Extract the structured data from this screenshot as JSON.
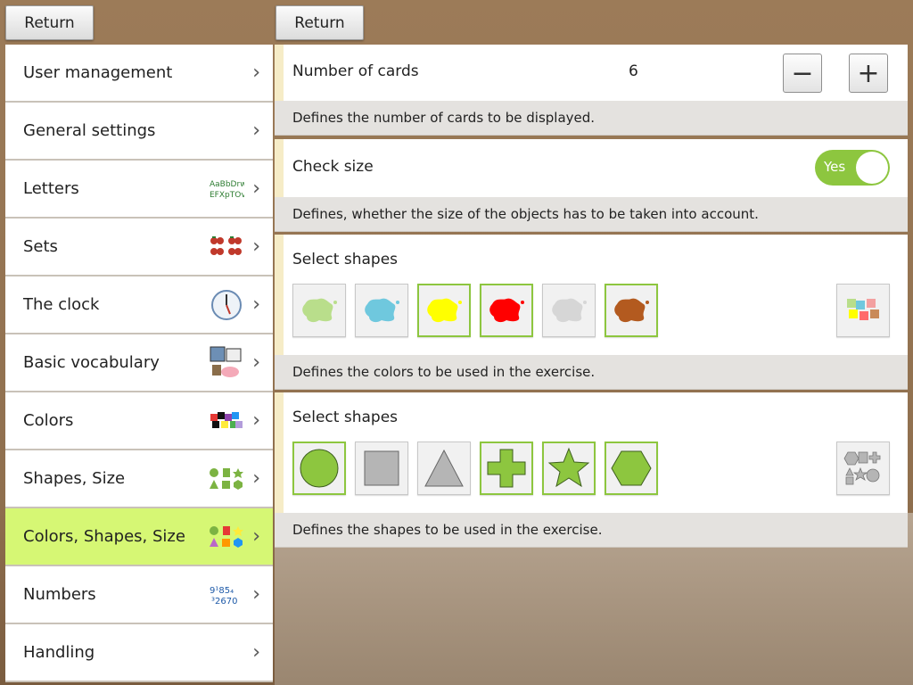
{
  "buttons": {
    "return_left": "Return",
    "return_right": "Return"
  },
  "menu": {
    "items": [
      {
        "label": "User management",
        "icon": "none",
        "active": false
      },
      {
        "label": "General settings",
        "icon": "none",
        "active": false
      },
      {
        "label": "Letters",
        "icon": "letters-icon",
        "active": false
      },
      {
        "label": "Sets",
        "icon": "strawberry-sets-icon",
        "active": false
      },
      {
        "label": "The clock",
        "icon": "clock-icon",
        "active": false
      },
      {
        "label": "Basic vocabulary",
        "icon": "vocabulary-icon",
        "active": false
      },
      {
        "label": "Colors",
        "icon": "color-puzzle-icon",
        "active": false
      },
      {
        "label": "Shapes, Size",
        "icon": "shapes-icon",
        "active": false
      },
      {
        "label": "Colors, Shapes, Size",
        "icon": "colored-shapes-icon",
        "active": true
      },
      {
        "label": "Numbers",
        "icon": "numbers-icon",
        "active": false
      },
      {
        "label": "Handling",
        "icon": "none",
        "active": false
      }
    ],
    "letters_icon_text": "AaBbDrwEFXpTOv",
    "numbers_icon_text": "9¹85₄³2670"
  },
  "settings": {
    "cards": {
      "label": "Number of cards",
      "value": "6",
      "minus": "−",
      "plus": "+",
      "description": "Defines the number of cards to be displayed."
    },
    "check_size": {
      "label": "Check size",
      "toggle_text": "Yes",
      "enabled": true,
      "description": "Defines, whether the size of the objects has to be taken into account."
    },
    "colors": {
      "label": "Select shapes",
      "swatches": [
        {
          "color": "#b9de8b",
          "selected": false
        },
        {
          "color": "#6fc8de",
          "selected": false
        },
        {
          "color": "#ffff00",
          "selected": true
        },
        {
          "color": "#ff0000",
          "selected": true
        },
        {
          "color": "#d6d6d6",
          "selected": false
        },
        {
          "color": "#b35a1f",
          "selected": true
        }
      ],
      "description": "Defines the colors to be used in the exercise."
    },
    "shapes": {
      "label": "Select shapes",
      "items": [
        {
          "shape": "circle",
          "selected": true
        },
        {
          "shape": "square",
          "selected": false
        },
        {
          "shape": "triangle",
          "selected": false
        },
        {
          "shape": "cross",
          "selected": true
        },
        {
          "shape": "star",
          "selected": true
        },
        {
          "shape": "hexagon",
          "selected": true
        }
      ],
      "description": "Defines the shapes to be used in the exercise."
    }
  },
  "colors": {
    "accent_green": "#8dc63f",
    "active_menu": "#d6f774",
    "selected_shape_fill": "#8dc63f",
    "unselected_shape_fill": "#b5b5b5"
  }
}
